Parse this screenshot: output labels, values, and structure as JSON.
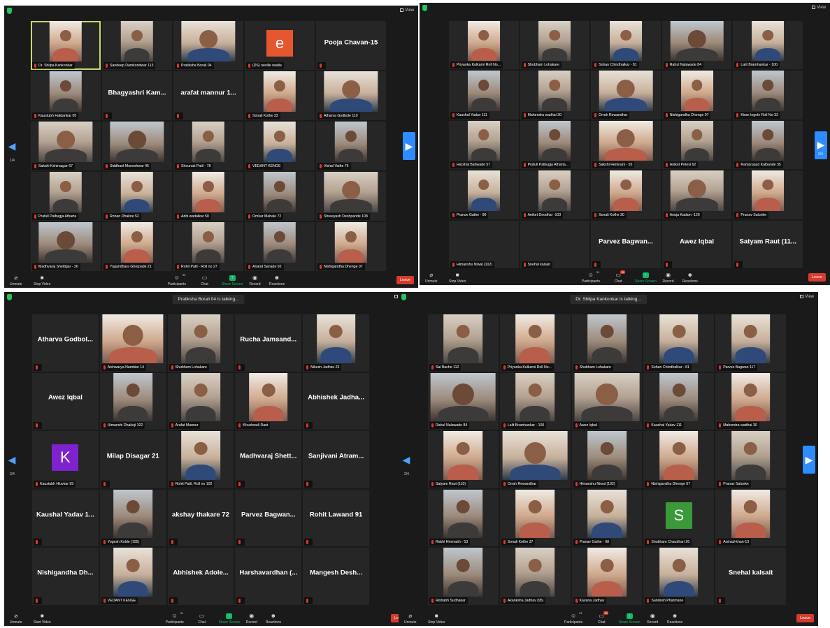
{
  "windows": [
    {
      "id": "w1",
      "talking": "",
      "view_label": "View",
      "page_indicator": "1/4",
      "has_left_arrow": true,
      "has_right_arrow": true,
      "participants_count": "90",
      "chat_badge": "",
      "toolbar": {
        "mute": "Unmute",
        "video": "Stop Video",
        "participants": "Participants",
        "chat": "Chat",
        "share": "Share Screen",
        "record": "Record",
        "reactions": "Reactions",
        "leave": "Leave"
      },
      "tiles": [
        {
          "label": "Dr. Shilpa Kankonkar",
          "kind": "photo",
          "tone": "t4",
          "active": true
        },
        {
          "label": "Sandeep Damkondwar 113",
          "kind": "photo",
          "tone": "t1"
        },
        {
          "label": "Pratiksha Borali 04",
          "kind": "photo",
          "tone": "t2",
          "wide": true
        },
        {
          "label": "(DS) neville wadia",
          "kind": "letter",
          "letter": "e",
          "color": "#e4572e"
        },
        {
          "label": "",
          "kind": "name",
          "name": "Pooja Chavan-15"
        },
        {
          "label": "Kaustubh Haldankar 05",
          "kind": "photo",
          "tone": "t3"
        },
        {
          "label": "",
          "kind": "name",
          "name": "Bhagyashri Kam..."
        },
        {
          "label": "",
          "kind": "name",
          "name": "arafat mannur 1..."
        },
        {
          "label": "Sonali Kothe 33",
          "kind": "photo",
          "tone": "t4"
        },
        {
          "label": "Atharva Godbole 119",
          "kind": "photo",
          "tone": "t2",
          "wide": true
        },
        {
          "label": "Sakshi Kshirsagar 67",
          "kind": "photo",
          "tone": "t1",
          "wide": true
        },
        {
          "label": "Siddhant Muneshwar 45",
          "kind": "photo",
          "tone": "t3",
          "wide": true
        },
        {
          "label": "Shounak Patil - 78",
          "kind": "photo",
          "tone": "t1"
        },
        {
          "label": "VEDANT KENGE",
          "kind": "photo",
          "tone": "t2"
        },
        {
          "label": "Vishal Vaitte 76",
          "kind": "photo",
          "tone": "t3"
        },
        {
          "label": "Prafull Palbugja Atharta",
          "kind": "photo",
          "tone": "t1"
        },
        {
          "label": "Rohan Dhakne 52",
          "kind": "photo",
          "tone": "t2"
        },
        {
          "label": "Aditi wadatkar 50",
          "kind": "photo",
          "tone": "t4"
        },
        {
          "label": "Omkar Mahale 72",
          "kind": "photo",
          "tone": "t3"
        },
        {
          "label": "Shreeyash Deshpande 108",
          "kind": "photo",
          "tone": "t1",
          "wide": true
        },
        {
          "label": "Madhvaraj Shettigar - 26",
          "kind": "photo",
          "tone": "t3",
          "wide": true
        },
        {
          "label": "Yugandhara Ghorpade 21",
          "kind": "photo",
          "tone": "t4"
        },
        {
          "label": "Rohit Patil - Roll no 27",
          "kind": "photo",
          "tone": "t1"
        },
        {
          "label": "Anand Sanade 92",
          "kind": "photo",
          "tone": "t3"
        },
        {
          "label": "Nishigandha Dhenge 07",
          "kind": "photo",
          "tone": "t4"
        }
      ]
    },
    {
      "id": "w2",
      "talking": "",
      "view_label": "View",
      "page_indicator": "2/4",
      "has_left_arrow": false,
      "has_right_arrow": true,
      "participants_count": "91",
      "chat_badge": "15",
      "toolbar": {
        "mute": "Unmute",
        "video": "Stop Video",
        "participants": "Participants",
        "chat": "Chat",
        "share": "Share Screen",
        "record": "Record",
        "reactions": "Reactions",
        "leave": "Leave"
      },
      "tiles": [
        {
          "label": "Priyanka Kulkarni Roll No...",
          "kind": "photo",
          "tone": "t4"
        },
        {
          "label": "Shubham Lohakare",
          "kind": "photo",
          "tone": "t1"
        },
        {
          "label": "Sohan Chindhalkar - 81",
          "kind": "photo",
          "tone": "t2"
        },
        {
          "label": "Rahul Nalawade 84",
          "kind": "photo",
          "tone": "t3",
          "wide": true
        },
        {
          "label": "Lalit Bramhankar - 100",
          "kind": "photo",
          "tone": "t2"
        },
        {
          "label": "Kaushal Yadav 111",
          "kind": "photo",
          "tone": "t3"
        },
        {
          "label": "Mahendra wadhai 30",
          "kind": "photo",
          "tone": "t1"
        },
        {
          "label": "Orrah Rewandhar",
          "kind": "photo",
          "tone": "t2",
          "wide": true
        },
        {
          "label": "Nishigandha Dhenge 07",
          "kind": "photo",
          "tone": "t4"
        },
        {
          "label": "Kiran Ingole Roll No-32",
          "kind": "photo",
          "tone": "t3"
        },
        {
          "label": "Harshal Bahwade 57",
          "kind": "photo",
          "tone": "t1"
        },
        {
          "label": "Prafull Palbugja Atharta...",
          "kind": "photo",
          "tone": "t3"
        },
        {
          "label": "Sakshi Hemnani - 55",
          "kind": "photo",
          "tone": "t4",
          "wide": true
        },
        {
          "label": "Aniket Petesi 62",
          "kind": "photo",
          "tone": "t1"
        },
        {
          "label": "Ramprasad Kalbande 35",
          "kind": "photo",
          "tone": "t3"
        },
        {
          "label": "Pranav Gathe - 90",
          "kind": "photo",
          "tone": "t2"
        },
        {
          "label": "Aniket Deodhar -103",
          "kind": "photo",
          "tone": "t1"
        },
        {
          "label": "Sonali Kothe 30",
          "kind": "photo",
          "tone": "t4"
        },
        {
          "label": "Anuja Kadam -126",
          "kind": "photo",
          "tone": "t1",
          "wide": true
        },
        {
          "label": "Pranav Salunke",
          "kind": "photo",
          "tone": "t4"
        },
        {
          "label": "Himanshu Niwal (102)",
          "kind": "blank"
        },
        {
          "label": "Snehal kalsait",
          "kind": "blank"
        },
        {
          "label": "",
          "kind": "name",
          "name": "Parvez Bagwan..."
        },
        {
          "label": "",
          "kind": "name",
          "name": "Awez Iqbal"
        },
        {
          "label": "",
          "kind": "name",
          "name": "Satyam Raut (11..."
        }
      ]
    },
    {
      "id": "w3",
      "talking": "Pratiksha Borali 04 is talking...",
      "view_label": "View",
      "page_indicator": "3/4",
      "has_left_arrow": true,
      "has_right_arrow": false,
      "participants_count": "91",
      "chat_badge": "",
      "toolbar": {
        "mute": "Unmute",
        "video": "Start Video",
        "participants": "Participants",
        "chat": "Chat",
        "share": "Share Screen",
        "record": "Record",
        "reactions": "Reactions",
        "leave": "Leave"
      },
      "tiles": [
        {
          "label": "",
          "kind": "name",
          "name": "Atharva Godbol..."
        },
        {
          "label": "Aishwarya Nambiar 14",
          "kind": "photo",
          "tone": "t4",
          "wide": true
        },
        {
          "label": "Shubham Lohakare",
          "kind": "photo",
          "tone": "t1"
        },
        {
          "label": "",
          "kind": "name",
          "name": "Rucha Jamsand..."
        },
        {
          "label": "Nikesh Jadhav 23",
          "kind": "photo",
          "tone": "t2"
        },
        {
          "label": "",
          "kind": "name",
          "name": "Awez Iqbal"
        },
        {
          "label": "Himanshi Dhakoji 102",
          "kind": "photo",
          "tone": "t3"
        },
        {
          "label": "Arafat Mannur",
          "kind": "photo",
          "tone": "t1"
        },
        {
          "label": "Khushwali Raut",
          "kind": "photo",
          "tone": "t4"
        },
        {
          "label": "",
          "kind": "name",
          "name": "Abhishek Jadha..."
        },
        {
          "label": "Kaustubh Hluvkar 99",
          "kind": "letter",
          "letter": "K",
          "color": "#7e22ce"
        },
        {
          "label": "",
          "kind": "name",
          "name": "Milap Disagar 21"
        },
        {
          "label": "Rohit Patil, Roll no 102",
          "kind": "photo",
          "tone": "t2"
        },
        {
          "label": "",
          "kind": "name",
          "name": "Madhvaraj Shett..."
        },
        {
          "label": "",
          "kind": "name",
          "name": "Sanjivani Atram..."
        },
        {
          "label": "",
          "kind": "name",
          "name": "Kaushal Yadav 1..."
        },
        {
          "label": "Yogesh Kolde (105)",
          "kind": "photo",
          "tone": "t3"
        },
        {
          "label": "",
          "kind": "name",
          "name": "akshay thakare 72"
        },
        {
          "label": "",
          "kind": "name",
          "name": "Parvez Bagwan..."
        },
        {
          "label": "",
          "kind": "name",
          "name": "Rohit Lawand 91"
        },
        {
          "label": "",
          "kind": "name",
          "name": "Nishigandha Dh..."
        },
        {
          "label": "VEDANT KENGE",
          "kind": "photo",
          "tone": "t2"
        },
        {
          "label": "",
          "kind": "name",
          "name": "Abhishek Adole..."
        },
        {
          "label": "",
          "kind": "name",
          "name": "Harshavardhan (..."
        },
        {
          "label": "",
          "kind": "name",
          "name": "Mangesh Desh..."
        }
      ]
    },
    {
      "id": "w4",
      "talking": "Dr. Shilpa Kankonkar is talking...",
      "view_label": "View",
      "page_indicator": "2/4",
      "has_left_arrow": true,
      "has_right_arrow": true,
      "participants_count": "91",
      "chat_badge": "15",
      "toolbar": {
        "mute": "Unmute",
        "video": "Stop Video",
        "participants": "Participants",
        "chat": "Chat",
        "share": "Share Screen",
        "record": "Record",
        "reactions": "Reactions",
        "leave": "Leave"
      },
      "tiles": [
        {
          "label": "Sai Bache 112",
          "kind": "photo",
          "tone": "t1"
        },
        {
          "label": "Priyanka Kulkarni Roll No...",
          "kind": "photo",
          "tone": "t4"
        },
        {
          "label": "Shubham Lohakare",
          "kind": "photo",
          "tone": "t3"
        },
        {
          "label": "Sohan Chindhalkar - 81",
          "kind": "photo",
          "tone": "t2"
        },
        {
          "label": "Parvez Bagwan 117",
          "kind": "photo",
          "tone": "t2"
        },
        {
          "label": "Rahul Nalawade 84",
          "kind": "photo",
          "tone": "t3",
          "wide": true
        },
        {
          "label": "Lalit Bramhankar - 100",
          "kind": "photo",
          "tone": "t1"
        },
        {
          "label": "Awez Iqbal",
          "kind": "photo",
          "tone": "t1",
          "wide": true
        },
        {
          "label": "Kaushal Yadav 111",
          "kind": "photo",
          "tone": "t3"
        },
        {
          "label": "Mahendra wadhai 30",
          "kind": "photo",
          "tone": "t4"
        },
        {
          "label": "Satyam Raut (110)",
          "kind": "photo",
          "tone": "t4"
        },
        {
          "label": "Orrah Rewandhar",
          "kind": "photo",
          "tone": "t2",
          "wide": true
        },
        {
          "label": "Himanshu Niwal (102)",
          "kind": "photo",
          "tone": "t3"
        },
        {
          "label": "Nishigandha Dhenge 07",
          "kind": "photo",
          "tone": "t4"
        },
        {
          "label": "Pranav Salunke",
          "kind": "photo",
          "tone": "t1"
        },
        {
          "label": "Rakhi Hiremath - 53",
          "kind": "photo",
          "tone": "t3"
        },
        {
          "label": "Sonali Kothe 37",
          "kind": "photo",
          "tone": "t4"
        },
        {
          "label": "Pranav Gathe - 98",
          "kind": "photo",
          "tone": "t2"
        },
        {
          "label": "Shubham Chaudhari 26",
          "kind": "letter",
          "letter": "S",
          "color": "#3a9a3a"
        },
        {
          "label": "Arshad-khan-13",
          "kind": "photo",
          "tone": "t4"
        },
        {
          "label": "Rishabh Sudhakar",
          "kind": "photo",
          "tone": "t3"
        },
        {
          "label": "Akanksha Jadhav (95)",
          "kind": "photo",
          "tone": "t1"
        },
        {
          "label": "Kavana Jadhav",
          "kind": "photo",
          "tone": "t4"
        },
        {
          "label": "Sandesh Pharmane",
          "kind": "photo",
          "tone": "t2"
        },
        {
          "label": "",
          "kind": "name",
          "name": "Snehal kalsait"
        }
      ]
    }
  ]
}
